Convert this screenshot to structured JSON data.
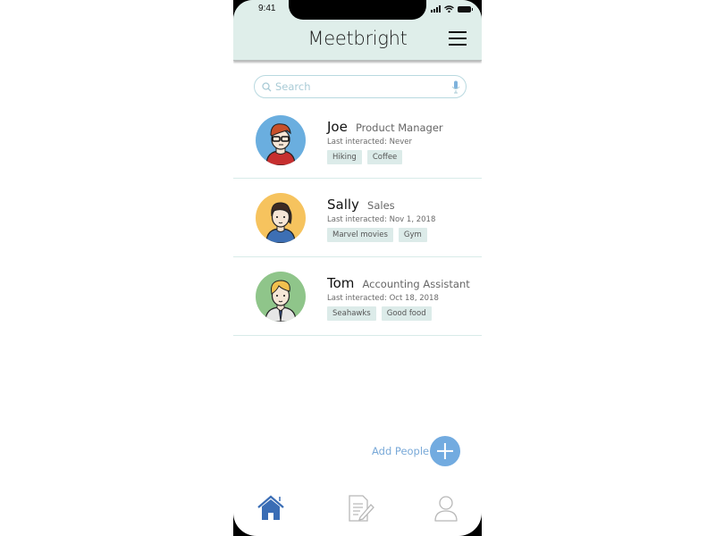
{
  "status_bar": {
    "time": "9:41",
    "icons": [
      "signal-icon",
      "wifi-icon",
      "battery-icon"
    ]
  },
  "header": {
    "app_title": "Meetbright",
    "menu_icon": "hamburger-menu-icon",
    "background_color": "#dfeeea"
  },
  "search": {
    "placeholder": "Search",
    "value": "",
    "icons": [
      "search-icon",
      "microphone-icon"
    ]
  },
  "contacts": [
    {
      "name": "Joe",
      "role": "Product Manager",
      "last_interacted": "Last interacted: Never",
      "tags": [
        "Hiking",
        "Coffee"
      ],
      "avatar_color": "#6aaedf"
    },
    {
      "name": "Sally",
      "role": "Sales",
      "last_interacted": "Last interacted: Nov 1, 2018",
      "tags": [
        "Marvel movies",
        "Gym"
      ],
      "avatar_color": "#f6c35e"
    },
    {
      "name": "Tom",
      "role": "Accounting Assistant",
      "last_interacted": "Last interacted: Oct 18, 2018",
      "tags": [
        "Seahawks",
        "Good food"
      ],
      "avatar_color": "#8fc58a"
    }
  ],
  "add_people": {
    "label": "Add People",
    "icon": "plus-icon",
    "color": "#72abe0"
  },
  "bottom_nav": [
    {
      "name": "Home",
      "icon": "home-icon",
      "active": true,
      "color": "#3a6db5"
    },
    {
      "name": "Notes",
      "icon": "notes-icon",
      "active": false,
      "color": "#b8b8b8"
    },
    {
      "name": "Profile",
      "icon": "profile-icon",
      "active": false,
      "color": "#b8b8b8"
    }
  ]
}
